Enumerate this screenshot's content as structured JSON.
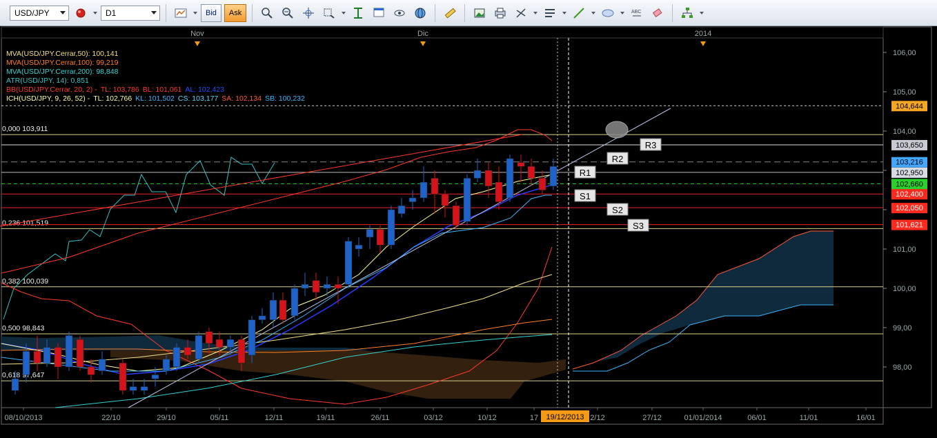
{
  "toolbar": {
    "symbol": "USD/JPY",
    "timeframe": "D1",
    "bid_label": "Bid",
    "ask_label": "Ask",
    "icons": [
      "chart-type-icon",
      "indicators-icon",
      "studies-icon",
      "zoom-in-icon",
      "zoom-out-icon",
      "crosshair-icon",
      "zoom-area-icon",
      "fit-icon",
      "properties-icon",
      "eye-icon",
      "globe-icon",
      "ruler-icon",
      "image-icon",
      "print-icon",
      "draw-tools-icon",
      "lines-icon",
      "trendline-icon",
      "ellipse-icon",
      "text-icon",
      "eraser-icon",
      "tree-icon"
    ]
  },
  "top_axis": {
    "labels": [
      "Nov",
      "Dic",
      "2014"
    ]
  },
  "indicators": [
    {
      "name": "MVA(USD/JPY.Cerrar,50): 100,141",
      "color": "#f3e08a"
    },
    {
      "name": "MVA(USD/JPY.Cerrar,100): 99,219",
      "color": "#ff7f27"
    },
    {
      "name": "MVA(USD/JPY.Cerrar,200): 98,848",
      "color": "#35d3d3"
    },
    {
      "name": "ATR(USD/JPY, 14): 0,851",
      "color": "#35c4c4"
    },
    {
      "parts": [
        {
          "text": "BB(USD/JPY.Cerrar, 20, 2) -",
          "color": "#ff3a2a"
        },
        {
          "text": "TL: 103,786",
          "color": "#ff3a2a"
        },
        {
          "text": "BL: 101,061",
          "color": "#ff3a2a"
        },
        {
          "text": "AL: 102,423",
          "color": "#1e4fff"
        }
      ]
    },
    {
      "parts": [
        {
          "text": "ICH(USD/JPY, 9, 26, 52) -",
          "color": "#ffff99"
        },
        {
          "text": "TL: 102,766",
          "color": "#ffff99"
        },
        {
          "text": "KL: 101,502",
          "color": "#3db6ff"
        },
        {
          "text": "CS: 103,177",
          "color": "#5ad6ff"
        },
        {
          "text": "SA: 102,134",
          "color": "#ff5a3a"
        },
        {
          "text": "SB: 100,232",
          "color": "#3db6ff"
        }
      ]
    }
  ],
  "fib_labels": [
    "0,000 103,911",
    "0,236 101,519",
    "0,382 100,039",
    "0,500 98,843",
    "0,618 97,647"
  ],
  "pivot_labels": [
    "R3",
    "R2",
    "R1",
    "S1",
    "S2",
    "S3"
  ],
  "price_axis": {
    "ticks": [
      "106,00",
      "105,00",
      "104,00",
      "103,00",
      "102,00",
      "101,00",
      "100,00",
      "99,00",
      "98,00"
    ]
  },
  "price_badges": [
    {
      "text": "104,644",
      "bg": "#f5a623",
      "fg": "#000000"
    },
    {
      "text": "103,650",
      "bg": "#c8cbd2",
      "fg": "#000000"
    },
    {
      "text": "103,216",
      "bg": "#43a6ff",
      "fg": "#000000"
    },
    {
      "text": "102,950",
      "bg": "#d8dbe2",
      "fg": "#000000"
    },
    {
      "text": "102,660",
      "bg": "#2bd12b",
      "fg": "#000000"
    },
    {
      "text": "102,400",
      "bg": "#ff2a1e",
      "fg": "#ffffff"
    },
    {
      "text": "102,050",
      "bg": "#ff2a1e",
      "fg": "#ffffff"
    },
    {
      "text": "101,621",
      "bg": "#ff2a1e",
      "fg": "#ffffff"
    }
  ],
  "date_axis": {
    "labels": [
      "08/10/2013",
      "22/10",
      "29/10",
      "05/11",
      "12/11",
      "19/11",
      "26/11",
      "03/12",
      "10/12",
      "17",
      "2/12",
      "27/12",
      "01/01/2014",
      "06/01",
      "11/01",
      "16/01"
    ],
    "cursor": "19/12/2013"
  },
  "colors": {
    "bull": "#1f63c9",
    "bear": "#d4141a",
    "background": "#000000",
    "cursor_badge": "#f39a16"
  }
}
